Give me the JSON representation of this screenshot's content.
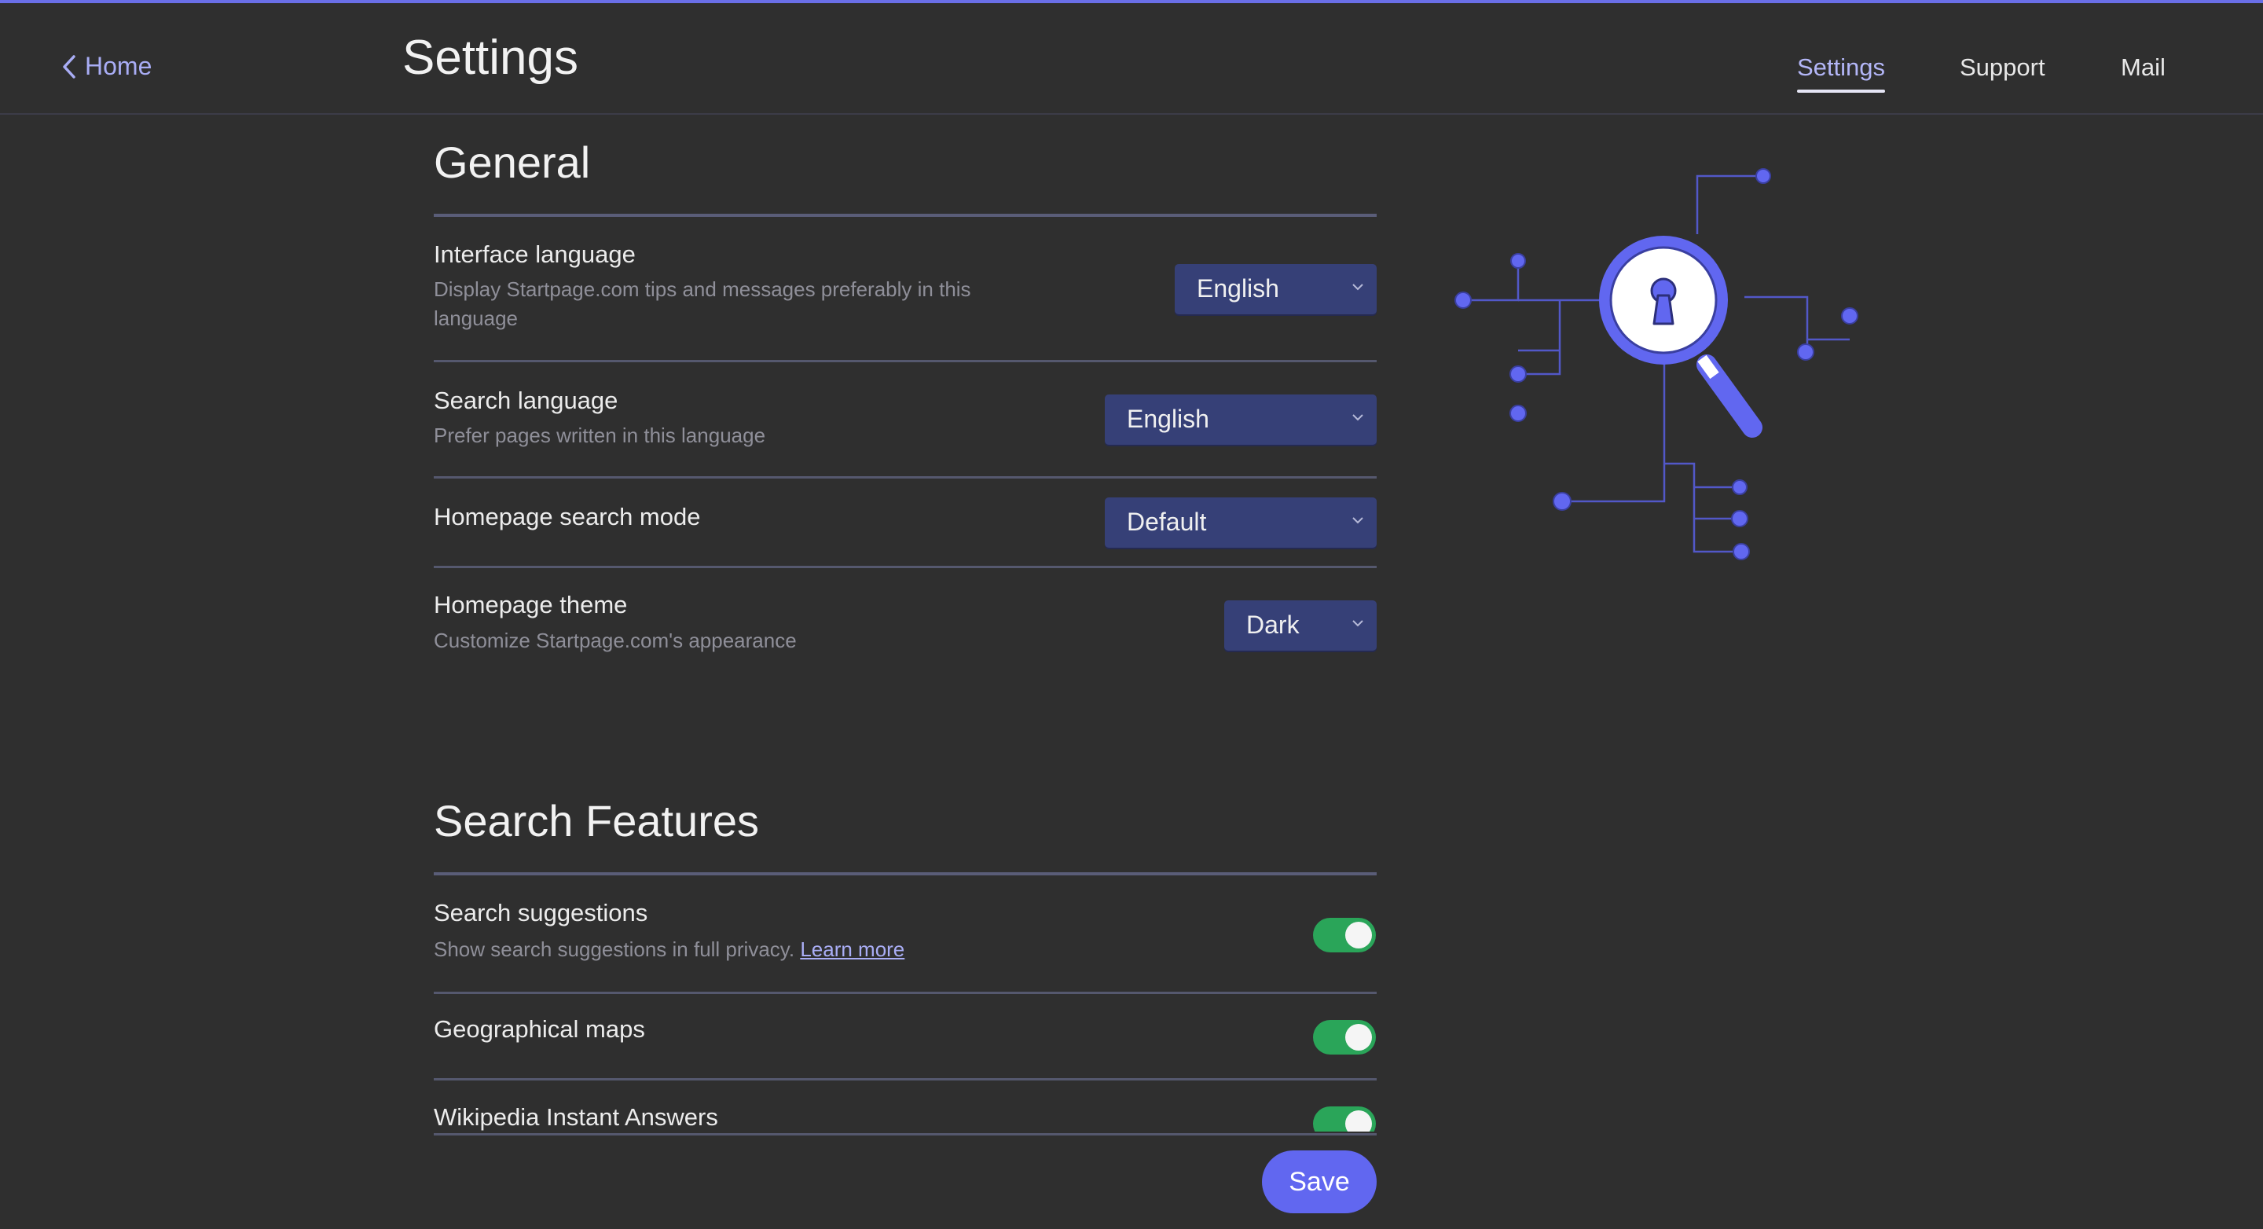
{
  "header": {
    "back_label": "Home",
    "title": "Settings",
    "nav": [
      {
        "label": "Settings",
        "active": true
      },
      {
        "label": "Support",
        "active": false
      },
      {
        "label": "Mail",
        "active": false
      }
    ]
  },
  "general": {
    "title": "General",
    "rows": [
      {
        "label": "Interface language",
        "description": "Display Startpage.com tips and messages preferably in this language",
        "value": "English"
      },
      {
        "label": "Search language",
        "description": "Prefer pages written in this language",
        "value": "English"
      },
      {
        "label": "Homepage search mode",
        "description": "",
        "value": "Default"
      },
      {
        "label": "Homepage theme",
        "description": "Customize Startpage.com's appearance",
        "value": "Dark"
      }
    ]
  },
  "search_features": {
    "title": "Search Features",
    "rows": [
      {
        "label": "Search suggestions",
        "description": "Show search suggestions in full privacy.",
        "link": "Learn more",
        "enabled": true
      },
      {
        "label": "Geographical maps",
        "enabled": true
      },
      {
        "label": "Wikipedia Instant Answers",
        "enabled": true
      }
    ]
  },
  "save_label": "Save",
  "colors": {
    "background": "#2f2f2f",
    "accent": "#6167f0",
    "select_bg": "#364077",
    "toggle_on": "#2aa559",
    "link": "#a9adf5"
  },
  "icons": [
    "chevron-left-icon",
    "chevron-down-icon",
    "magnifier-keyhole-illustration"
  ]
}
